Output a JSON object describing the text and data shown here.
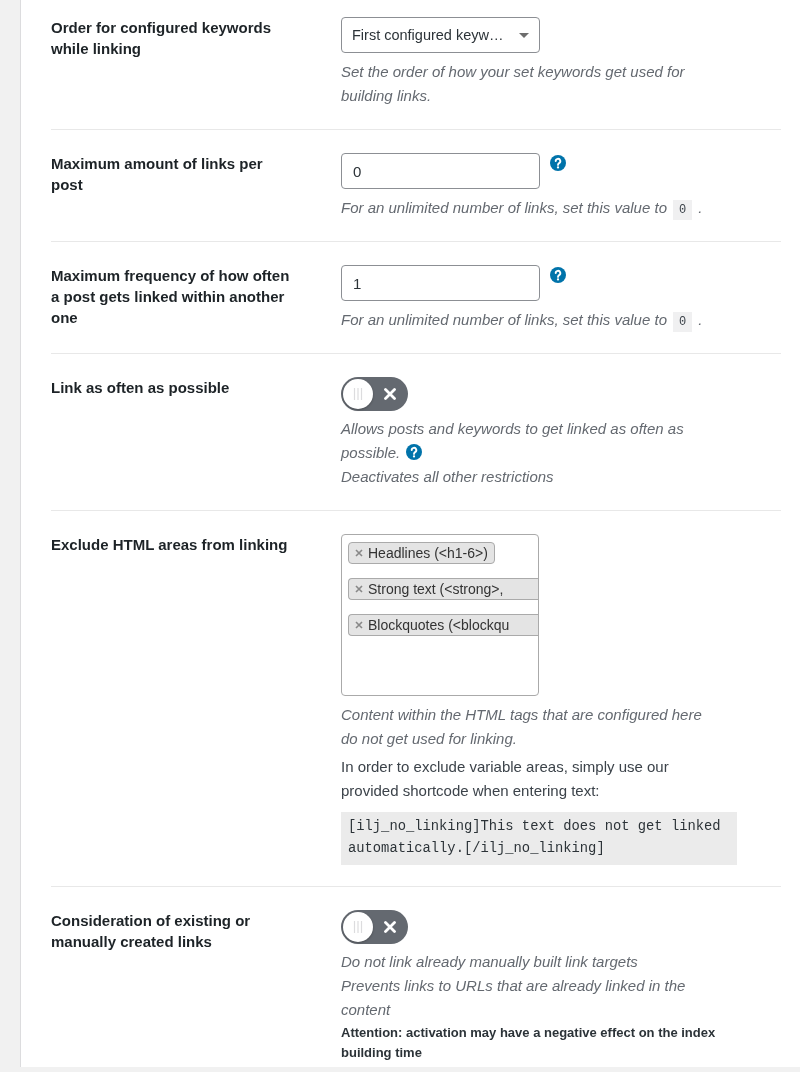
{
  "settings": [
    {
      "kind": "select",
      "label": "Order for configured keywords while linking",
      "value": "First configured keyw…",
      "notes": [
        {
          "kind": "note",
          "text": "Set the order of how your set keywords get used for building links."
        }
      ]
    },
    {
      "kind": "number",
      "label": "Maximum amount of links per post",
      "value": "0",
      "help": true,
      "notes": [
        {
          "kind": "note",
          "text": "For an unlimited number of links, set this value to",
          "code": "0",
          "after": "."
        }
      ]
    },
    {
      "kind": "number",
      "label": "Maximum frequency of how often a post gets linked within another one",
      "value": "1",
      "help": true,
      "notes": [
        {
          "kind": "note",
          "text": "For an unlimited number of links, set this value to",
          "code": "0",
          "after": "."
        }
      ]
    },
    {
      "kind": "toggle",
      "label": "Link as often as possible",
      "on": false,
      "notes": [
        {
          "kind": "note",
          "text": "Allows posts and keywords to get linked as often as"
        },
        {
          "kind": "note",
          "text": "possible.",
          "help": true
        },
        {
          "kind": "note",
          "text": "Deactivates all other restrictions"
        }
      ]
    },
    {
      "kind": "multiselect",
      "label": "Exclude HTML areas from linking",
      "tags": [
        {
          "label": "Headlines (<h1-6>)",
          "cut_off": false
        },
        {
          "label": "Strong text (<strong>,",
          "cut_off": true
        },
        {
          "label": "Blockquotes (<blockqu",
          "cut_off": true
        }
      ],
      "notes": [
        {
          "kind": "note",
          "text": "Content within the HTML tags that are configured here do not get used for linking."
        },
        {
          "kind": "text",
          "text": "In order to exclude variable areas, simply use our provided shortcode when entering text:"
        },
        {
          "kind": "code",
          "text": "[ilj_no_linking]This text does not get linked automatically.[/ilj_no_linking]"
        }
      ]
    },
    {
      "kind": "toggle",
      "label": "Consideration of existing or manually created links",
      "on": false,
      "notes": [
        {
          "kind": "note",
          "text": "Do not link already manually built link targets"
        },
        {
          "kind": "note",
          "text": "Prevents links to URLs that are already linked in the content"
        },
        {
          "kind": "attention",
          "text": "Attention: activation may have a negative effect on the index building time"
        }
      ]
    }
  ]
}
